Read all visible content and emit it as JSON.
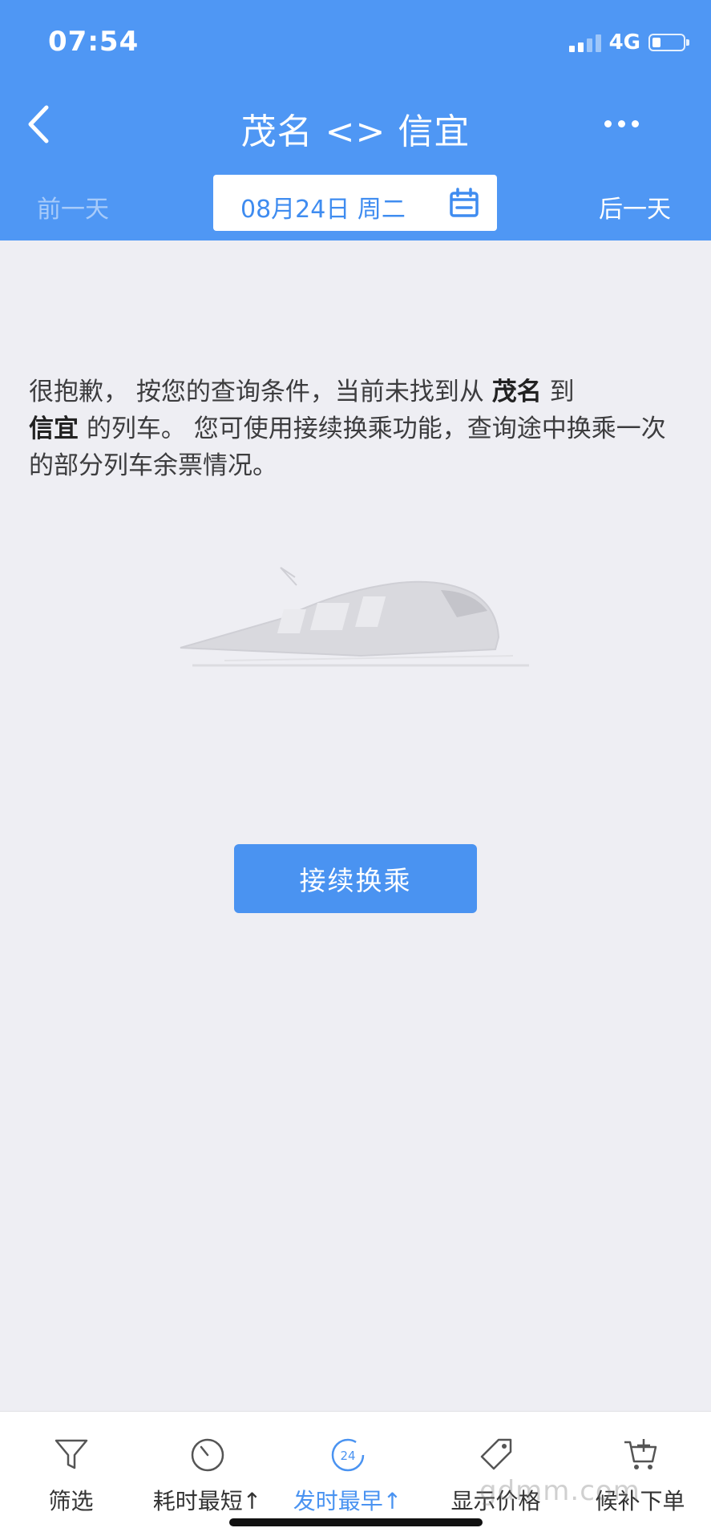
{
  "status_bar": {
    "time": "07:54",
    "network": "4G"
  },
  "header": {
    "title": "茂名 <> 信宜",
    "prev_day": "前一天",
    "next_day": "后一天",
    "date": "08月24日 周二"
  },
  "message": {
    "part1": "很抱歉， 按您的查询条件，当前未找到从 ",
    "from": "茂名",
    "part2": " 到",
    "to": "信宜",
    "part3": " 的列车。 您可使用接续换乘功能，查询途中换乘一次的部分列车余票情况。"
  },
  "transfer_button": "接续换乘",
  "tabs": [
    {
      "label": "筛选",
      "icon": "filter-icon"
    },
    {
      "label": "耗时最短↑",
      "icon": "timer-icon"
    },
    {
      "label": "发时最早↑",
      "icon": "clock-24-icon",
      "active_badge": "24"
    },
    {
      "label": "显示价格",
      "icon": "price-tag-icon"
    },
    {
      "label": "候补下单",
      "icon": "cart-add-icon"
    }
  ],
  "watermark": "gdmm.com",
  "colors": {
    "header_bg": "#4f97f4",
    "accent": "#4a93f1",
    "page_bg": "#eeeef3"
  }
}
